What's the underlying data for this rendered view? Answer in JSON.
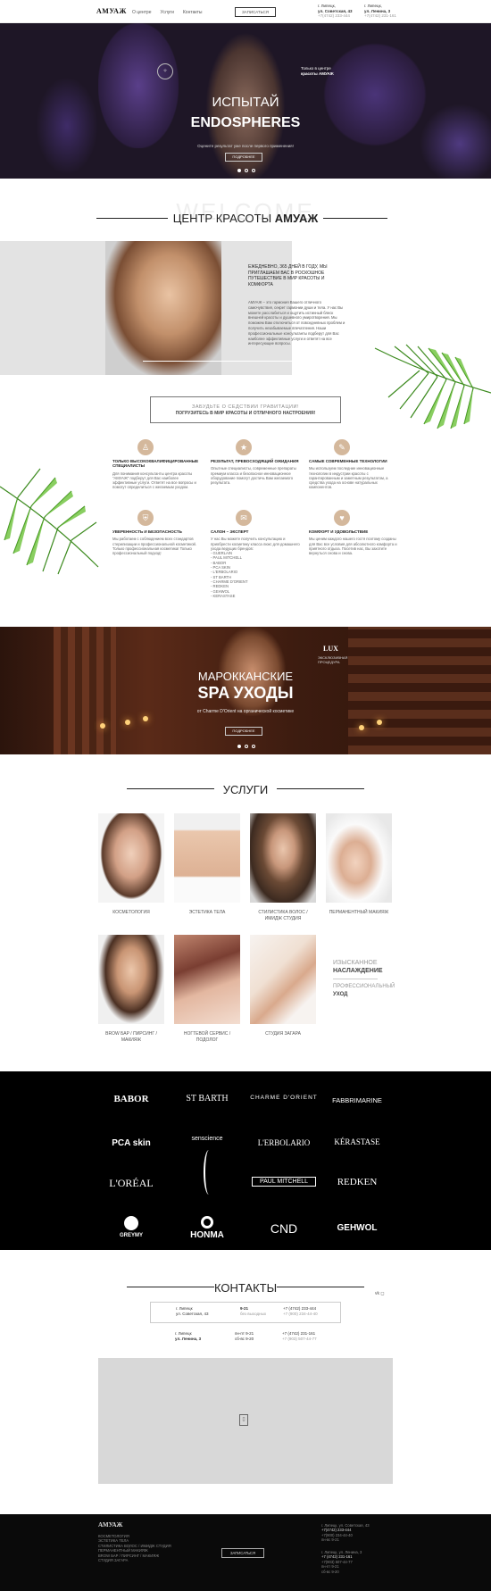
{
  "header": {
    "logo": "AMУАЖ",
    "nav": [
      "О центре",
      "Услуги",
      "Контакты"
    ],
    "cta": "ЗАПИСАТЬСЯ",
    "addr1": [
      "г. Липецк,",
      "ул. Советская, 43",
      "+7(4742) 233-444"
    ],
    "addr2": [
      "г. Липецк,",
      "ул. Ленина, 3",
      "+7(4742) 231-161"
    ]
  },
  "hero": {
    "side": [
      "Только в центре",
      "красоты АМУАЖ"
    ],
    "title1": "ИСПЫТАЙ",
    "title2": "ENDOSPHERES",
    "sub": "Оцените результат уже после первого применения!",
    "btn": "ПОДРОБНЕЕ"
  },
  "welcome": {
    "bg": "WELCOME",
    "title_a": "ЦЕНТР КРАСОТЫ ",
    "title_b": "АМУАЖ",
    "lead": "ЕЖЕДНЕВНО, 365 ДНЕЙ В ГОДУ, МЫ ПРИГЛАШАЕМ ВАС В РОСКОШНОЕ ПУТЕШЕСТВИЕ В МИР КРАСОТЫ И КОМФОРТА",
    "body": "АМУАЖ – это гармония Вашего отличного самочувствия, секрет гармонии души и тела. У нас Вы можете расслабиться и ощутить истинный блеск внешней красоты и душевного умиротворения. Мы поможем Вам отключиться от повседневных проблем и получить незабываемые впечатления. Наши профессиональные консультанты подберут для Вас наиболее эффективные услуги и ответят на все интересующие вопросы."
  },
  "cta_box": {
    "line1": "ЗАБУДЬТЕ О СЕДСТВИИ ГРАВИТАЦИИ!",
    "line2": "ПОГРУЗИТЕСЬ В МИР КРАСОТЫ И ОТЛИЧНОГО НАСТРОЕНИЯ!"
  },
  "features": [
    {
      "title": "ТОЛЬКО ВЫСОКОКВАЛИФИЦИРОВАННЫЕ СПЕЦИАЛИСТЫ",
      "text": "Для понимания консультанты центра красоты \"АМУАЖ\" подберут для Вас наиболее эффективные услуги. Ответят на все вопросы и помогут определиться с желаемым уходом.",
      "icon": "person-icon"
    },
    {
      "title": "РЕЗУЛЬТАТ, ПРЕВОСХОДЯЩИЙ ОЖИДАНИЯ",
      "text": "Опытные специалисты, современные препараты премиум класса и безопасное инновационное оборудование помогут достичь Вам желаемого результата.",
      "icon": "star-icon"
    },
    {
      "title": "САМЫЕ СОВРЕМЕННЫЕ ТЕХНОЛОГИИ",
      "text": "Мы используем последние инновационные технологии в индустрии красоты с гарантированным и заметным результатом, а средства ухода на основе натуральных компонентов.",
      "icon": "drop-icon"
    },
    {
      "title": "УВЕРЕННОСТЬ И БЕЗОПАСНОСТЬ",
      "text": "Мы работаем с соблюдением всех стандартов стерилизации и профессиональной косметикой. Только профессиональная косметика! Только профессиональный подход!",
      "icon": "shield-icon"
    },
    {
      "title": "САЛОН – ЭКСПЕРТ",
      "text": "У нас Вы можете получить консультацию и приобрести косметику класса люкс для домашнего ухода ведущих брендов:",
      "list": [
        "- GUERLAIN",
        "- PAUL MITCHELL",
        "- BABOR",
        "- PCA SKIN",
        "- L'ERBOLARIO",
        "- ST BARTH",
        "- CHARME D'ORIENT",
        "- REDKEN",
        "- GEHWOL",
        "- KERASTASE"
      ],
      "icon": "chat-icon"
    },
    {
      "title": "КОМФОРТ И УДОВОЛЬСТВИЕ",
      "text": "Мы ценим каждого нашего гостя поэтому созданы для Вас все условия для абсолютного комфорта и приятного отдыха. Посетив нас, Вы захотите вернуться снова и снова.",
      "icon": "heart-icon"
    }
  ],
  "spa": {
    "t1": "МАРОККАНСКИЕ",
    "t2": "SPA УХОДЫ",
    "t3": "от Charme D'Orient на органической косметике",
    "btn": "ПОДРОБНЕЕ",
    "lux": "LUX",
    "lux_sub": [
      "ЭКСКЛЮЗИВНАЯ",
      "ПРОЦЕДУРА"
    ]
  },
  "services": {
    "title": "УСЛУГИ",
    "items": [
      {
        "label": "КОСМЕТОЛОГИЯ"
      },
      {
        "label": "ЭСТЕТИКА ТЕЛА"
      },
      {
        "label": "СТИЛИСТИКА ВОЛОС / ИМИДЖ СТУДИЯ"
      },
      {
        "label": "ПЕРМАНЕНТНЫЙ МАКИЯЖ"
      },
      {
        "label": "BROW БАР / ПИРСИНГ / МАКИЯЖ"
      },
      {
        "label": "НОГТЕВОЙ СЕРВИС / ПОДОЛОГ"
      },
      {
        "label": "СТУДИЯ ЗАГАРА"
      }
    ],
    "promo": [
      "ИЗЫСКАННОЕ",
      "НАСЛАЖДЕНИЕ",
      "ПРОФЕССИОНАЛЬНЫЙ",
      "УХОД"
    ]
  },
  "brands": [
    "BABOR",
    "ST BARTH",
    "CHARME D'ORIENT",
    "FABBRIMARINE",
    "PCA skin",
    "senscience",
    "L'ERBOLARIO",
    "KÉRASTASE",
    "L'ORÉAL",
    "PAUL MITCHELL",
    "REDKEN",
    "GREYMY",
    "HONMA",
    "CND",
    "GEHWOL"
  ],
  "contacts": {
    "title": "КОНТАКТЫ",
    "row1": {
      "city": "г. Липецк",
      "street": "ул. Советская, 43",
      "hours": "9-21",
      "hours_note": "без выходных",
      "phone": "+7 (4742) 233-444",
      "phone2": "+7 (900) 234-44-40"
    },
    "row2": {
      "city": "г. Липецк",
      "street": "ул. Ленина, 3",
      "hours1": "пн-пт 9-21",
      "hours2": "сб-вс 9-20",
      "phone": "+7 (4742) 231-161",
      "phone2": "+7 (903) 507-44-77"
    }
  },
  "footer": {
    "logo": "АМУАЖ",
    "links": [
      "КОСМЕТОЛОГИЯ",
      "ЭСТЕТИКА ТЕЛА",
      "СТИЛИСТИКА ВОЛОС / ИМИДЖ СТУДИЯ",
      "ПЕРМАНЕНТНЫЙ МАКИЯЖ",
      "BROW БАР / ПИРСИНГ / МАКИЯЖ",
      "СТУДИЯ ЗАГАРА"
    ],
    "cta": "ЗАПИСАТЬСЯ",
    "addr1": [
      "г. Липецк, ул. Советская, 43",
      "+7(4742) 233-444",
      "+7(900) 234-44-40",
      "пн-вс 9-21"
    ],
    "addr2": [
      "г. Липецк, ул. Ленина, 3",
      "+7 (4742) 231-161",
      "+7(903) 507-44-77",
      "пн-пт 9-21",
      "сб-вс 9-20"
    ]
  }
}
